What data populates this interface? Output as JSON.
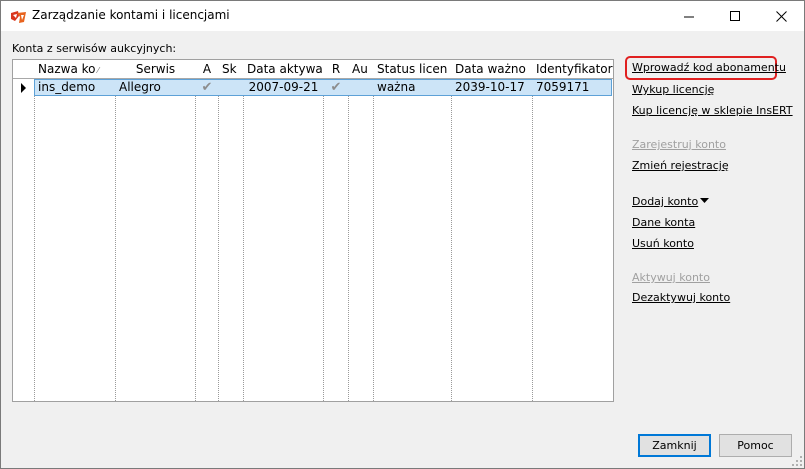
{
  "window": {
    "title": "Zarządzanie kontami i licencjami",
    "controls": {
      "minimize": "—",
      "maximize": "☐",
      "close": "✕"
    }
  },
  "accounts": {
    "section_label": "Konta z serwisów aukcyjnych:",
    "columns": [
      "Nazwa ko",
      "Serwis",
      "A",
      "Sk",
      "Data aktywa",
      "R",
      "Au",
      "Status licen",
      "Data ważno",
      "Identyfikator"
    ],
    "rows": [
      {
        "name": "ins_demo",
        "service": "Allegro",
        "a_checked": true,
        "sk": "",
        "activation_date": "2007-09-21",
        "r_checked": true,
        "au": "",
        "license_status": "ważna",
        "valid_until": "2039-10-17",
        "identifier": "7059171"
      }
    ]
  },
  "actions": {
    "enter_subscription_code": "Wprowadź kod abonamentu",
    "buy_license": "Wykup licencję",
    "buy_license_store": "Kup licencję w sklepie InsERT",
    "register_account": "Zarejestruj konto",
    "change_registration": "Zmień rejestrację",
    "add_account": "Dodaj konto",
    "account_details": "Dane konta",
    "delete_account": "Usuń konto",
    "activate_account": "Aktywuj konto",
    "deactivate_account": "Dezaktywuj konto"
  },
  "buttons": {
    "close": "Zamknij",
    "help": "Pomoc"
  },
  "colors": {
    "selection": "#cce4f7",
    "selection_border": "#5da1d7",
    "highlight": "#e02020",
    "disabled_text": "#a0a0a0"
  }
}
